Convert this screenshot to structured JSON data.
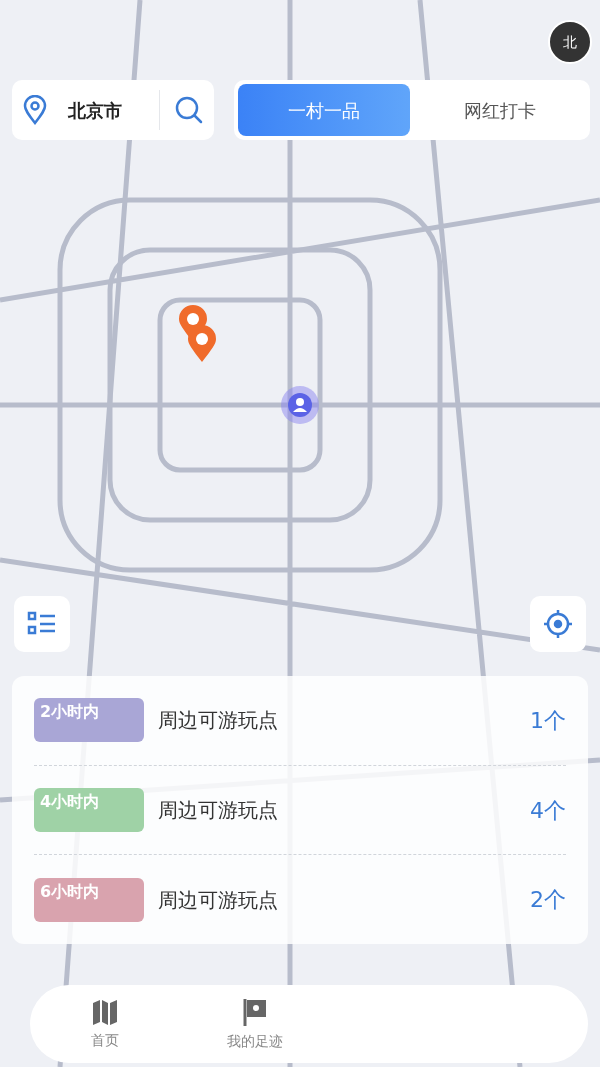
{
  "compass": {
    "label": "北"
  },
  "location": {
    "city": "北京市"
  },
  "tabs": [
    {
      "label": "一村一品",
      "selected": true
    },
    {
      "label": "网红打卡",
      "selected": false
    }
  ],
  "routes": [
    {
      "badge": "2小时内",
      "label": "周边可游玩点",
      "count": "1个",
      "color": "#a9a6d6"
    },
    {
      "badge": "4小时内",
      "label": "周边可游玩点",
      "count": "4个",
      "color": "#9fd2a6"
    },
    {
      "badge": "6小时内",
      "label": "周边可游玩点",
      "count": "2个",
      "color": "#d9a3ae"
    }
  ],
  "nav": [
    {
      "label": "首页",
      "kind": "map"
    },
    {
      "label": "我的足迹",
      "kind": "flag"
    }
  ]
}
